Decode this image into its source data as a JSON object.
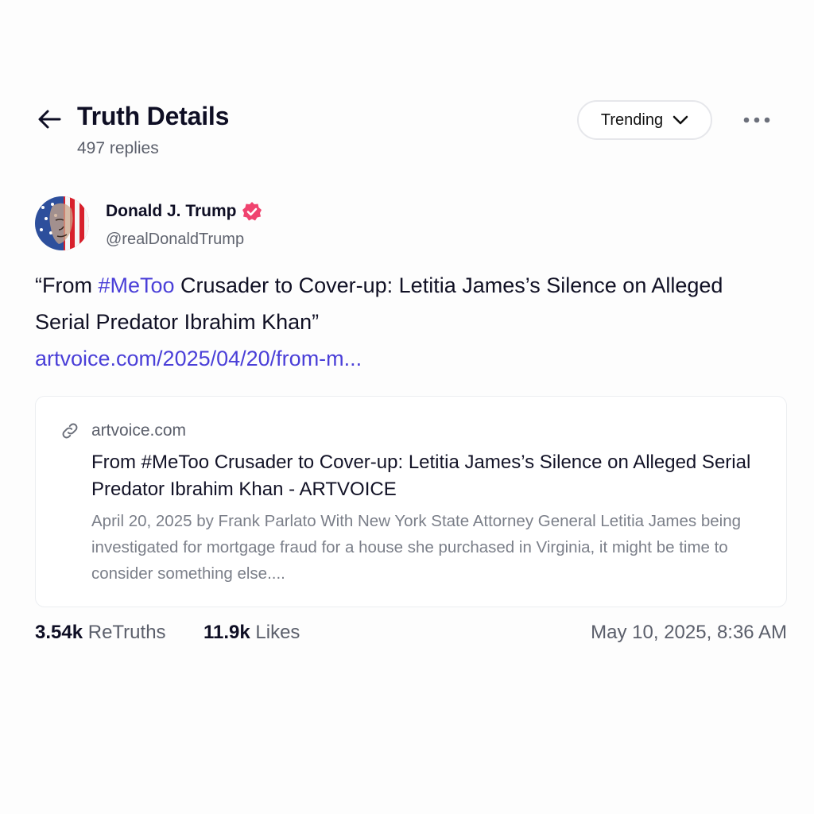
{
  "header": {
    "title": "Truth Details",
    "replies": "497 replies",
    "sort_label": "Trending",
    "icons": [
      "arrow-left-icon",
      "chevron-down-icon",
      "more-horizontal-icon"
    ]
  },
  "author": {
    "name": "Donald J. Trump",
    "handle": "@realDonaldTrump",
    "verified": true,
    "verified_color": "#f0436f"
  },
  "post": {
    "text_before": "“From ",
    "hashtag": "#MeToo",
    "text_after": " Crusader to Cover-up: Letitia James’s Silence on Alleged Serial Predator Ibrahim Khan”",
    "link": "artvoice.com/2025/04/20/from-m..."
  },
  "link_card": {
    "domain": "artvoice.com",
    "title": "From #MeToo Crusader to Cover-up: Letitia James’s Silence on Alleged Serial Predator Ibrahim Khan - ARTVOICE",
    "description": "April 20, 2025 by Frank Parlato With New York State Attorney General Letitia James being investigated for mortgage fraud for a house she purchased in Virginia, it might be time to consider something else...."
  },
  "stats": {
    "retruths_count": "3.54k",
    "retruths_label": "ReTruths",
    "likes_count": "11.9k",
    "likes_label": "Likes",
    "timestamp": "May 10, 2025, 8:36 AM"
  },
  "colors": {
    "accent": "#4a3fd8",
    "text": "#0e0e24",
    "muted": "#5b5f6b"
  }
}
